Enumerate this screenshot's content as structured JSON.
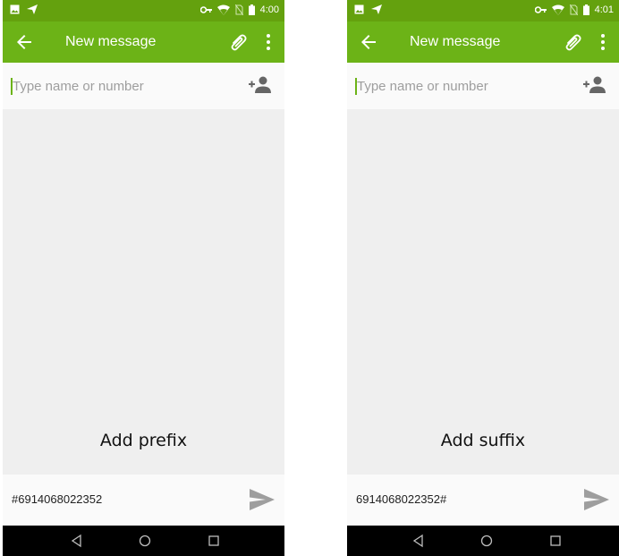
{
  "screens": [
    {
      "status": {
        "time": "4:00"
      },
      "toolbar": {
        "title": "New message"
      },
      "recipient": {
        "placeholder": "Type name or number"
      },
      "caption": "Add prefix",
      "compose": {
        "text": "#6914068022352"
      }
    },
    {
      "status": {
        "time": "4:01"
      },
      "toolbar": {
        "title": "New message"
      },
      "recipient": {
        "placeholder": "Type name or number"
      },
      "caption": "Add suffix",
      "compose": {
        "text": "6914068022352#"
      }
    }
  ],
  "colors": {
    "statusbar": "#64a10e",
    "toolbar": "#6cb317",
    "background": "#efefef",
    "navbar": "#000000"
  },
  "icons": {
    "status_left": [
      "image-icon",
      "send-notification-icon"
    ],
    "status_right": [
      "vpn-key-icon",
      "wifi-icon",
      "no-sim-icon",
      "battery-icon"
    ],
    "toolbar": [
      "back-arrow-icon",
      "attach-icon",
      "more-vert-icon"
    ],
    "recipient": "add-person-icon",
    "compose": "send-icon",
    "navbar": [
      "back-triangle-icon",
      "home-circle-icon",
      "recents-square-icon"
    ]
  }
}
